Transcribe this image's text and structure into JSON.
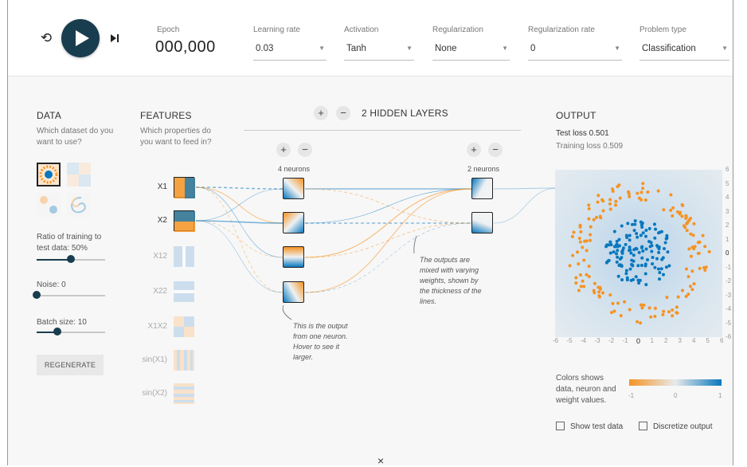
{
  "controls": {
    "epoch_label": "Epoch",
    "epoch_value": "000,000",
    "reset_glyph": "⟲",
    "icons": {
      "reset": "reset-icon",
      "play": "play-icon",
      "step": "step-forward-icon"
    }
  },
  "params": [
    {
      "label": "Learning rate",
      "value": "0.03"
    },
    {
      "label": "Activation",
      "value": "Tanh"
    },
    {
      "label": "Regularization",
      "value": "None"
    },
    {
      "label": "Regularization rate",
      "value": "0"
    },
    {
      "label": "Problem type",
      "value": "Classification"
    }
  ],
  "chevron": "▼",
  "data_panel": {
    "title": "DATA",
    "question": "Which dataset do you want to use?",
    "ratio_label": "Ratio of training to test data:  50%",
    "ratio": 0.5,
    "noise_label": "Noise:  0",
    "noise": 0,
    "batch_label": "Batch size:  10",
    "batch": 0.3,
    "regenerate": "REGENERATE"
  },
  "features": {
    "title": "FEATURES",
    "question": "Which properties do you want to feed in?",
    "items": [
      {
        "label": "X1",
        "active": true
      },
      {
        "label": "X2",
        "active": true
      },
      {
        "label": "X12",
        "active": false
      },
      {
        "label": "X22",
        "active": false
      },
      {
        "label": "X1X2",
        "active": false
      },
      {
        "label": "sin(X1)",
        "active": false
      },
      {
        "label": "sin(X2)",
        "active": false
      }
    ]
  },
  "hidden": {
    "plus": "+",
    "minus": "−",
    "title": "2  HIDDEN LAYERS",
    "layer1": "4 neurons",
    "layer2": "2 neurons"
  },
  "notes": {
    "node": "This is the output from one neuron. Hover to see it larger.",
    "weights": "The outputs are mixed with varying weights, shown by the thickness of the lines."
  },
  "output": {
    "title": "OUTPUT",
    "test_loss": "Test loss 0.501",
    "train_loss": "Training loss 0.509",
    "xticks": [
      "-6",
      "-5",
      "-4",
      "-3",
      "-2",
      "-1",
      "0",
      "1",
      "2",
      "3",
      "4",
      "5",
      "6"
    ],
    "yticks": [
      "6",
      "5",
      "4",
      "3",
      "2",
      "1",
      "0",
      "-1",
      "-2",
      "-3",
      "-4",
      "-5",
      "-6"
    ],
    "legend": "Colors shows data, neuron and weight values.",
    "legend_ticks": [
      "-1",
      "0",
      "1"
    ],
    "show_test": "Show test data",
    "discretize": "Discretize output"
  },
  "colors": {
    "orange": "#f59322",
    "blue": "#0877bd",
    "dark": "#183d4e"
  },
  "bottom_glyph": "×"
}
